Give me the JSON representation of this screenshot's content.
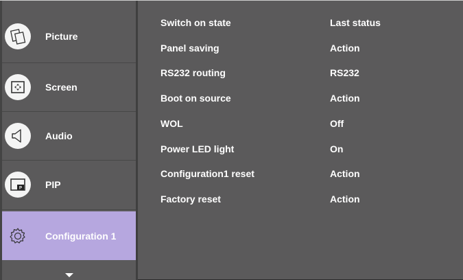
{
  "sidebar": {
    "items": [
      {
        "label": "Picture",
        "icon": "picture-icon",
        "active": false
      },
      {
        "label": "Screen",
        "icon": "screen-icon",
        "active": false
      },
      {
        "label": "Audio",
        "icon": "audio-icon",
        "active": false
      },
      {
        "label": "PIP",
        "icon": "pip-icon",
        "active": false,
        "icon_text": "P"
      },
      {
        "label": "Configuration 1",
        "icon": "configuration-icon",
        "active": true
      }
    ],
    "scroll_icon": "chevron-down-icon"
  },
  "settings": {
    "rows": [
      {
        "label": "Switch on state",
        "value": "Last status"
      },
      {
        "label": "Panel saving",
        "value": "Action"
      },
      {
        "label": "RS232 routing",
        "value": "RS232"
      },
      {
        "label": "Boot on source",
        "value": "Action"
      },
      {
        "label": "WOL",
        "value": "Off"
      },
      {
        "label": "Power LED light",
        "value": "On"
      },
      {
        "label": "Configuration1 reset",
        "value": "Action"
      },
      {
        "label": "Factory reset",
        "value": "Action"
      }
    ]
  },
  "colors": {
    "panel_bg": "#5b5a5b",
    "active_bg": "#b6a7df",
    "text": "#ffffff"
  }
}
